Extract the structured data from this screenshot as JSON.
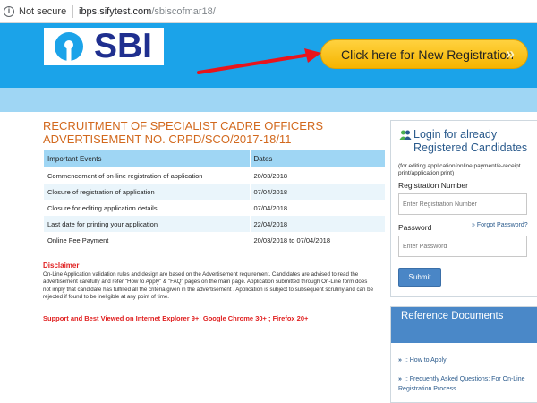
{
  "browser": {
    "security_label": "Not secure",
    "url_host": "ibps.sifytest.com",
    "url_path": "/sbiscofmar18/"
  },
  "header": {
    "logo_text": "SBI",
    "registration_button": "Click here for New Registration",
    "registration_chevron": "»"
  },
  "main": {
    "title": "RECRUITMENT OF SPECIALIST CADRE OFFICERS ADVERTISEMENT NO. CRPD/SCO/2017-18/11",
    "table_headers": [
      "Important Events",
      "Dates"
    ],
    "events": [
      {
        "event": "Commencement of on-line registration of application",
        "date": "20/03/2018"
      },
      {
        "event": "Closure of registration of application",
        "date": "07/04/2018"
      },
      {
        "event": "Closure for editing application details",
        "date": "07/04/2018"
      },
      {
        "event": "Last date for printing your application",
        "date": "22/04/2018"
      },
      {
        "event": "Online Fee Payment",
        "date": "20/03/2018 to 07/04/2018"
      }
    ],
    "disclaimer_title": "Disclaimer",
    "disclaimer_text": "On-Line Application validation rules and design are based on the Advertisement requirement. Candidates are advised to read the advertisement carefully and refer \"How to Apply\" & \"FAQ\" pages on the main page. Application submitted through On-Line form does not imply that candidate has fulfilled all the criteria given in the advertisement . Application is subject to subsequent scrutiny and can be rejected if found to be ineligible at any point of time.",
    "support_text": "Support and Best Viewed on Internet Explorer 9+; Google Chrome 30+ ; Firefox 20+"
  },
  "login": {
    "title_line1": "Login for already",
    "title_line2": "Registered Candidates",
    "note": "(for editing application/online payment/e-receipt print/application print)",
    "registration_label": "Registration Number",
    "registration_placeholder": "Enter Registration Number",
    "password_label": "Password",
    "forgot_label": "Forgot Password?",
    "forgot_prefix": "»",
    "password_placeholder": "Enter Password",
    "submit_label": "Submit"
  },
  "reference": {
    "title": "Reference Documents",
    "items": [
      {
        "prefix": "»",
        "label": ":: How to Apply"
      },
      {
        "prefix": "»",
        "label": ":: Frequently Asked Questions: For On-Line Registration Process"
      }
    ]
  },
  "colors": {
    "header_blue": "#1ba3e9",
    "subheader_blue": "#9fd6f4",
    "title_orange": "#d2691e",
    "button_yellow": "#ffd23f",
    "disclaimer_red": "#e02020",
    "reference_header": "#4a88c8"
  }
}
